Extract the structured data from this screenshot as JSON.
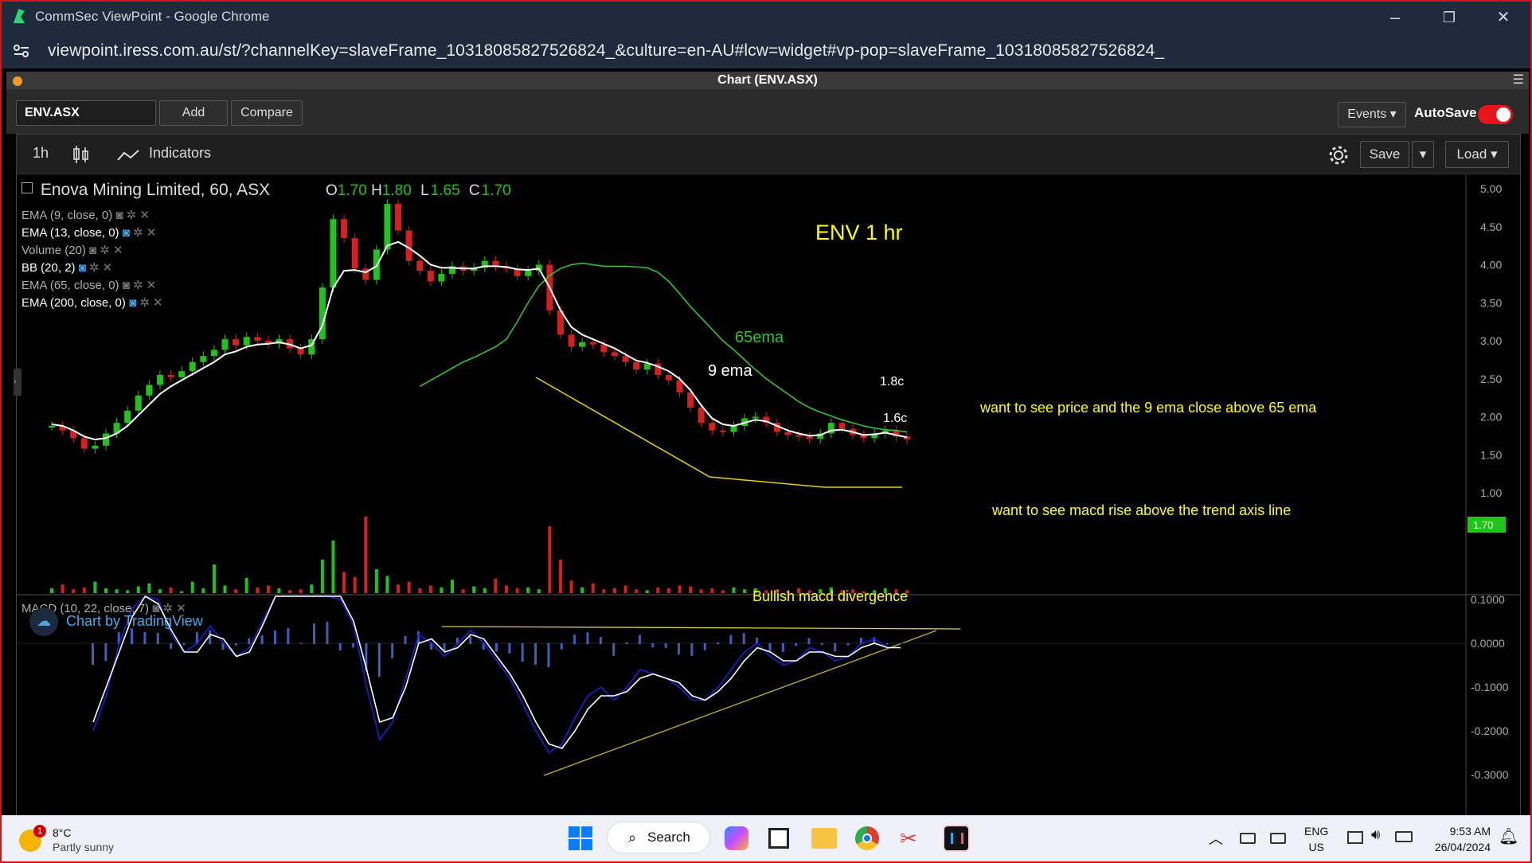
{
  "browser": {
    "title": "CommSec ViewPoint - Google Chrome",
    "url": "viewpoint.iress.com.au/st/?channelKey=slaveFrame_10318085827526824_&culture=en-AU#lcw=widget#vp-pop=slaveFrame_10318085827526824_",
    "controls": {
      "minimize": "–",
      "restore": "❐",
      "close": "✕"
    }
  },
  "panel": {
    "title": "Chart (ENV.ASX)",
    "menu": "☰"
  },
  "controls": {
    "symbol": "ENV.ASX",
    "add": "Add",
    "compare": "Compare",
    "events": "Events ▾",
    "autosave": "AutoSave",
    "autosave_on": true
  },
  "toolbar": {
    "interval": "1h",
    "indicators": "Indicators",
    "save": "Save",
    "save_menu": "▾",
    "load": "Load ▾"
  },
  "legend": {
    "title": "Enova Mining Limited, 60, ASX",
    "ohlc": [
      {
        "k": "O",
        "v": "1.70"
      },
      {
        "k": "H",
        "v": "1.80"
      },
      {
        "k": "L",
        "v": "1.65"
      },
      {
        "k": "C",
        "v": "1.70"
      }
    ],
    "studies": [
      "EMA (9, close, 0)",
      "EMA (13, close, 0)",
      "Volume (20)",
      "BB (20, 2)",
      "EMA (65, close, 0)",
      "EMA (200, close, 0)"
    ],
    "macd": "MACD (10, 22, close, 7)"
  },
  "annotations": {
    "title": "ENV 1 hr",
    "ema65": "65ema",
    "ema9": "9 ema",
    "res": "1.8c",
    "sup": "1.6c",
    "note1": "want to see price and the 9 ema close above 65 ema",
    "note2": "want to see macd rise above the trend axis line",
    "note3": "Bullish macd divergence"
  },
  "branding": "Chart by TradingView",
  "price_axis": {
    "ticks": [
      "5.00",
      "4.50",
      "4.00",
      "3.50",
      "3.00",
      "2.50",
      "2.00",
      "1.50",
      "1.00"
    ],
    "last_price": "1.70"
  },
  "macd_axis": {
    "ticks": [
      "0.1000",
      "0.0000",
      "-0.1000",
      "-0.2000",
      "-0.3000"
    ]
  },
  "taskbar": {
    "weather_temp": "8°C",
    "weather_desc": "Partly sunny",
    "weather_badge": "1",
    "search": "Search",
    "lang1": "ENG",
    "lang2": "US",
    "time": "9:53 AM",
    "date": "26/04/2024"
  },
  "colors": {
    "up": "#21c21c",
    "down": "#d42020",
    "ema9": "#ffffff",
    "ema65": "#33c233",
    "annot": "#ffff00",
    "macd_line": "#1b20d6"
  },
  "chart_data": {
    "type": "line",
    "title": "ENV 1 hr",
    "ylim": [
      1.0,
      5.0
    ],
    "close": [
      1.88,
      1.82,
      1.72,
      1.58,
      1.62,
      1.78,
      1.92,
      2.08,
      2.28,
      2.42,
      2.55,
      2.52,
      2.6,
      2.72,
      2.8,
      2.88,
      3.02,
      2.94,
      3.05,
      3.0,
      2.96,
      3.02,
      2.9,
      2.82,
      3.02,
      3.7,
      4.6,
      4.35,
      3.95,
      3.8,
      4.2,
      4.8,
      4.45,
      4.05,
      3.92,
      3.78,
      3.88,
      3.98,
      3.92,
      3.96,
      4.05,
      3.98,
      3.95,
      3.85,
      3.92,
      4.0,
      3.4,
      3.08,
      2.92,
      2.98,
      2.95,
      2.85,
      2.8,
      2.72,
      2.62,
      2.7,
      2.55,
      2.48,
      2.32,
      2.12,
      1.92,
      1.82,
      1.8,
      1.88,
      1.98,
      2.0,
      1.92,
      1.8,
      1.76,
      1.74,
      1.71,
      1.78,
      1.92,
      1.84,
      1.76,
      1.72,
      1.78,
      1.82,
      1.74,
      1.7
    ],
    "ema9": [
      1.9,
      1.88,
      1.82,
      1.74,
      1.7,
      1.72,
      1.78,
      1.88,
      2.02,
      2.16,
      2.3,
      2.4,
      2.48,
      2.56,
      2.64,
      2.72,
      2.82,
      2.86,
      2.92,
      2.95,
      2.96,
      2.98,
      2.95,
      2.9,
      2.94,
      3.2,
      3.7,
      3.92,
      3.93,
      3.9,
      3.98,
      4.25,
      4.3,
      4.22,
      4.12,
      4.0,
      3.96,
      3.96,
      3.95,
      3.95,
      3.98,
      3.98,
      3.97,
      3.94,
      3.93,
      3.95,
      3.7,
      3.4,
      3.18,
      3.08,
      3.02,
      2.96,
      2.9,
      2.82,
      2.74,
      2.71,
      2.66,
      2.6,
      2.5,
      2.35,
      2.15,
      1.98,
      1.9,
      1.88,
      1.92,
      1.96,
      1.94,
      1.88,
      1.82,
      1.78,
      1.75,
      1.76,
      1.82,
      1.83,
      1.8,
      1.76,
      1.77,
      1.79,
      1.76,
      1.73
    ],
    "ema65": [
      2.4,
      2.48,
      2.56,
      2.64,
      2.72,
      2.78,
      2.85,
      2.92,
      3.02,
      3.25,
      3.5,
      3.72,
      3.86,
      3.95,
      4.0,
      4.02,
      4.0,
      3.98,
      3.98,
      3.98,
      3.97,
      3.96,
      3.9,
      3.78,
      3.62,
      3.45,
      3.3,
      3.15,
      3.0,
      2.88,
      2.75,
      2.62,
      2.5,
      2.4,
      2.3,
      2.2,
      2.12,
      2.06,
      2.01,
      1.96,
      1.92,
      1.88,
      1.85,
      1.83,
      1.82,
      1.8
    ],
    "volume": [
      0.05,
      0.09,
      0.04,
      0.06,
      0.12,
      0.05,
      0.04,
      0.03,
      0.07,
      0.1,
      0.04,
      0.06,
      0.02,
      0.12,
      0.05,
      0.3,
      0.08,
      0.04,
      0.16,
      0.06,
      0.08,
      0.05,
      0.03,
      0.04,
      0.09,
      0.35,
      0.55,
      0.22,
      0.17,
      0.8,
      0.25,
      0.18,
      0.09,
      0.12,
      0.05,
      0.08,
      0.06,
      0.14,
      0.04,
      0.07,
      0.05,
      0.15,
      0.08,
      0.05,
      0.06,
      0.04,
      0.7,
      0.35,
      0.13,
      0.06,
      0.1,
      0.04,
      0.05,
      0.08,
      0.04,
      0.03,
      0.06,
      0.05,
      0.08,
      0.07,
      0.04,
      0.05,
      0.03,
      0.06,
      0.04,
      0.05,
      0.03,
      0.04,
      0.02,
      0.05,
      0.03,
      0.04,
      0.06,
      0.03,
      0.04,
      0.02,
      0.03,
      0.05,
      0.04,
      0.03
    ],
    "macd": [
      -0.2,
      -0.12,
      0.0,
      0.08,
      0.12,
      0.1,
      0.02,
      -0.02,
      0.0,
      0.04,
      0.0,
      -0.03,
      -0.01,
      0.05,
      0.15,
      0.2,
      0.12,
      0.18,
      0.22,
      0.1,
      0.04,
      -0.1,
      -0.22,
      -0.18,
      -0.08,
      0.02,
      0.0,
      -0.03,
      0.0,
      0.03,
      0.0,
      -0.04,
      -0.08,
      -0.14,
      -0.2,
      -0.25,
      -0.23,
      -0.17,
      -0.12,
      -0.1,
      -0.13,
      -0.1,
      -0.06,
      -0.07,
      -0.08,
      -0.1,
      -0.13,
      -0.13,
      -0.1,
      -0.06,
      -0.02,
      0.0,
      -0.03,
      -0.05,
      -0.04,
      -0.01,
      -0.02,
      -0.04,
      -0.03,
      0.0,
      0.01,
      -0.01,
      -0.01
    ],
    "signal": [
      -0.18,
      -0.1,
      -0.02,
      0.06,
      0.11,
      0.09,
      0.03,
      -0.02,
      -0.02,
      0.02,
      0.01,
      -0.03,
      -0.02,
      0.04,
      0.14,
      0.19,
      0.13,
      0.16,
      0.2,
      0.12,
      0.05,
      -0.06,
      -0.18,
      -0.17,
      -0.1,
      0.0,
      0.01,
      -0.02,
      -0.01,
      0.02,
      0.01,
      -0.03,
      -0.07,
      -0.12,
      -0.18,
      -0.23,
      -0.24,
      -0.2,
      -0.15,
      -0.12,
      -0.12,
      -0.11,
      -0.08,
      -0.07,
      -0.08,
      -0.09,
      -0.12,
      -0.13,
      -0.11,
      -0.08,
      -0.04,
      -0.01,
      -0.02,
      -0.04,
      -0.04,
      -0.02,
      -0.02,
      -0.03,
      -0.03,
      -0.01,
      0.0,
      -0.01,
      -0.01
    ]
  }
}
